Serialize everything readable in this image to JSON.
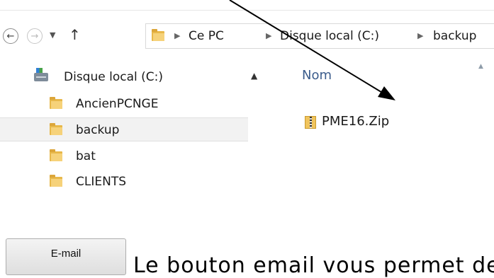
{
  "address_bar": {
    "breadcrumbs": [
      "Ce PC",
      "Disque local (C:)",
      "backup"
    ],
    "icons": {
      "back": "arrow-left-circle-icon",
      "forward": "arrow-right-circle-icon",
      "recent": "chevron-down-icon",
      "up": "arrow-up-icon",
      "location": "folder-icon",
      "separator": "chevron-right-icon"
    }
  },
  "nav_pane": {
    "drive_label": "Disque local (C:)",
    "folders": [
      {
        "label": "AncienPCNGE",
        "selected": false
      },
      {
        "label": "backup",
        "selected": true
      },
      {
        "label": "bat",
        "selected": false
      },
      {
        "label": "CLIENTS",
        "selected": false
      }
    ]
  },
  "file_pane": {
    "column_header": "Nom",
    "files": [
      {
        "label": "PME16.Zip",
        "icon": "zip-folder-icon"
      }
    ]
  },
  "email_button": {
    "label": "E-mail"
  },
  "doc_text": "Le bouton email vous permet de",
  "colors": {
    "header_text": "#3b5c8c",
    "selection": "#f2f2f2",
    "folder": "#e8b84a"
  }
}
